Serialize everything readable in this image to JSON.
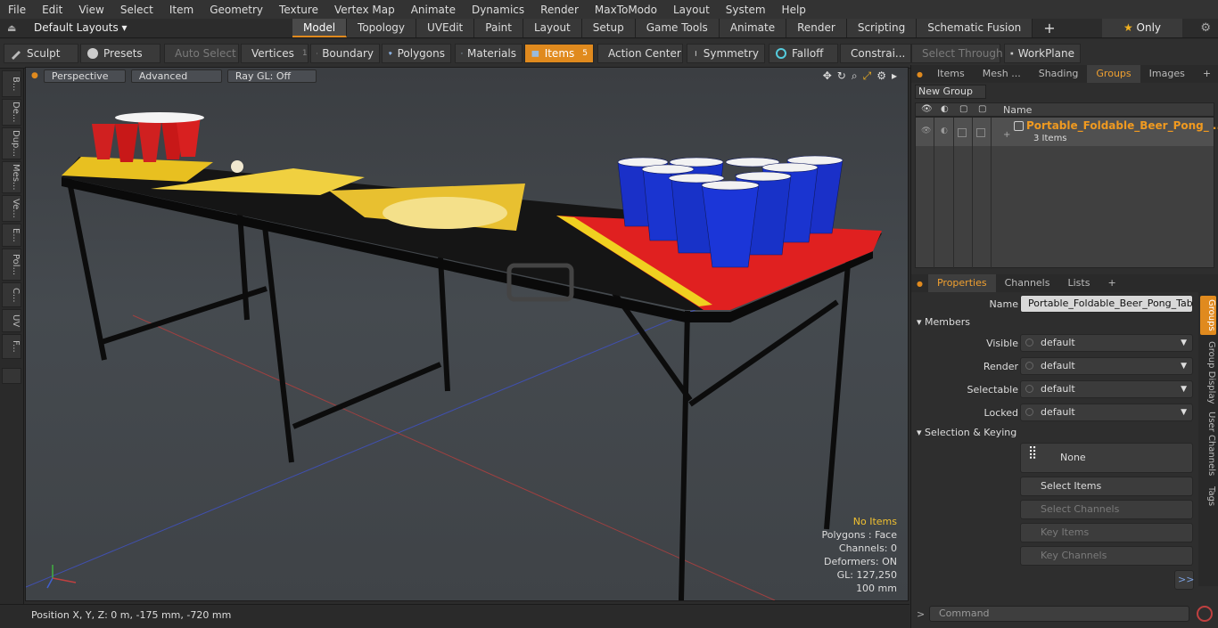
{
  "menu": [
    "File",
    "Edit",
    "View",
    "Select",
    "Item",
    "Geometry",
    "Texture",
    "Vertex Map",
    "Animate",
    "Dynamics",
    "Render",
    "MaxToModo",
    "Layout",
    "System",
    "Help"
  ],
  "layout": {
    "layouts_label": "Default Layouts ▾",
    "tabs": [
      "Model",
      "Topology",
      "UVEdit",
      "Paint",
      "Layout",
      "Setup",
      "Game Tools",
      "Animate",
      "Render",
      "Scripting",
      "Schematic Fusion"
    ],
    "active_tab": "Model",
    "only_label": "Only"
  },
  "toolbar": {
    "sculpt": "Sculpt",
    "presets": "Presets",
    "auto_select": "Auto Select",
    "vertices": "Vertices",
    "vertices_count": "1",
    "boundary": "Boundary",
    "polygons": "Polygons",
    "materials": "Materials",
    "items": "Items",
    "items_count": "5",
    "action_center": "Action Center",
    "symmetry": "Symmetry",
    "falloff": "Falloff",
    "constraints": "Constrai...",
    "select_through": "Select Through",
    "workplane": "WorkPlane"
  },
  "left_tabs": [
    "B...",
    "De...",
    "Dup...",
    "Mes...",
    "Ve...",
    "E...",
    "Pol...",
    "C...",
    "UV",
    "F..."
  ],
  "viewport": {
    "view_mode": "Perspective",
    "shading": "Advanced",
    "raygl": "Ray GL: Off",
    "info": {
      "selection": "No Items",
      "polygons": "Polygons : Face",
      "channels": "Channels: 0",
      "deformers": "Deformers: ON",
      "gl": "GL: 127,250",
      "scale": "100 mm"
    }
  },
  "status": {
    "position": "Position X, Y, Z:   0 m, -175 mm, -720 mm"
  },
  "groups_panel": {
    "tabs": [
      "Items",
      "Mesh ...",
      "Shading",
      "Groups",
      "Images"
    ],
    "active_tab": "Groups",
    "new_group": "New Group",
    "col_name": "Name",
    "group_name": "Portable_Foldable_Beer_Pong_ ...",
    "group_count": "3 Items"
  },
  "properties": {
    "tabs": [
      "Properties",
      "Channels",
      "Lists"
    ],
    "active_tab": "Properties",
    "name_label": "Name",
    "name_value": "Portable_Foldable_Beer_Pong_Table (",
    "members": "Members",
    "visible_label": "Visible",
    "visible_value": "default",
    "render_label": "Render",
    "render_value": "default",
    "selectable_label": "Selectable",
    "selectable_value": "default",
    "locked_label": "Locked",
    "locked_value": "default",
    "sel_keying": "Selection & Keying",
    "none_label": "None",
    "select_items": "Select Items",
    "select_channels": "Select Channels",
    "key_items": "Key Items",
    "key_channels": "Key Channels",
    "more": ">>",
    "side_tabs": [
      "Groups",
      "Group Display",
      "User Channels",
      "Tags"
    ]
  },
  "command": {
    "placeholder": "Command",
    "prompt": ">"
  }
}
